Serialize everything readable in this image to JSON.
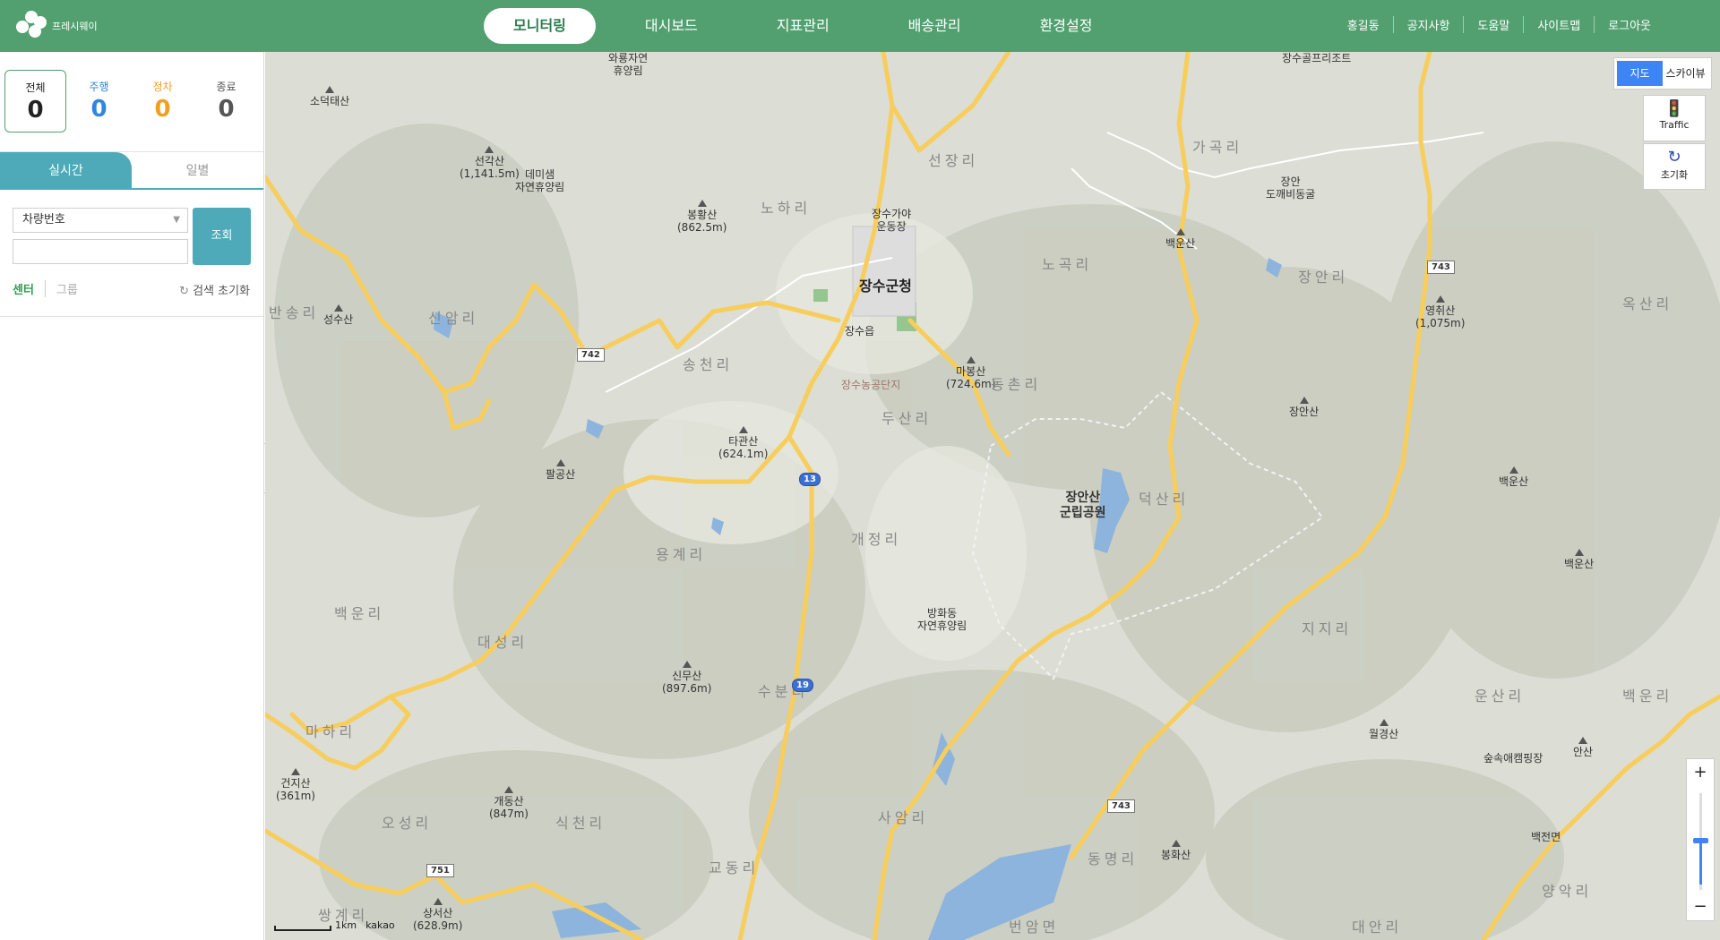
{
  "header": {
    "logo_text": "프레시웨이",
    "nav": [
      "모니터링",
      "대시보드",
      "지표관리",
      "배송관리",
      "환경설정"
    ],
    "utils": [
      "홍길동",
      "공지사항",
      "도움말",
      "사이트맵",
      "로그아웃"
    ]
  },
  "stats": [
    {
      "label": "전체",
      "value": "0",
      "color": "#222222"
    },
    {
      "label": "주행",
      "value": "0",
      "color": "#2e86de"
    },
    {
      "label": "정차",
      "value": "0",
      "color": "#f0a020"
    },
    {
      "label": "종료",
      "value": "0",
      "color": "#555555"
    }
  ],
  "tabs": [
    "실시간",
    "일별"
  ],
  "search": {
    "select_value": "차량번호",
    "input_value": "",
    "button": "조회",
    "filter_center": "센터",
    "filter_group": "그룹",
    "reset": "검색 초기화"
  },
  "map": {
    "type_options": [
      "지도",
      "스카이뷰"
    ],
    "traffic": "Traffic",
    "reset": "초기화",
    "zoom_in": "+",
    "zoom_out": "−",
    "scale": "1km",
    "provider": "kakao",
    "places": {
      "p1": "소덕태산",
      "p2": "선각산",
      "p2e": "(1,141.5m)",
      "p3": "데미샘",
      "p3b": "자연휴양림",
      "p4": "봉황산",
      "p4e": "(862.5m)",
      "p5": "와룡자연",
      "p5b": "휴양림",
      "p6": "성수산",
      "p7": "팔공산",
      "p8": "타관산",
      "p8e": "(624.1m)",
      "p9": "마봉산",
      "p9e": "(724.6m)",
      "p10": "장수가야",
      "p10b": "운동장",
      "p11": "장수군청",
      "p12": "장수읍",
      "p13": "장수농공단지",
      "p14": "장안산",
      "p14b": "군립공원",
      "p15": "방화동",
      "p15b": "자연휴양림",
      "p16": "신무산",
      "p16e": "(897.6m)",
      "p17": "개동산",
      "p17e": "(847m)",
      "p18": "건지산",
      "p18e": "(361m)",
      "p19": "상서산",
      "p19e": "(628.9m)",
      "p20": "장수골프리조트",
      "p21": "장안",
      "p21b": "도깨비동굴",
      "p22": "백운산",
      "p23": "영취산",
      "p23e": "(1,075m)",
      "p24": "장안산",
      "p25": "백운산",
      "p26": "백운산",
      "p27": "월경산",
      "p28": "숲속애캠핑장",
      "p29": "안산",
      "p30": "봉화산",
      "p31": "백전면",
      "r1": "선장리",
      "r2": "노하리",
      "r3": "가곡리",
      "r4": "노곡리",
      "r5": "장안리",
      "r6": "옥산리",
      "r7": "반송리",
      "r8": "신암리",
      "r9": "송천리",
      "r10": "두산리",
      "r11": "동촌리",
      "r12": "덕산리",
      "r13": "개정리",
      "r14": "용계리",
      "r15": "백운리",
      "r16": "대성리",
      "r17": "수분리",
      "r18": "지지리",
      "r19": "운산리",
      "r20": "백운리",
      "r21": "마하리",
      "r22": "오성리",
      "r23": "식천리",
      "r24": "사암리",
      "r25": "교동리",
      "r26": "동명리",
      "r27": "쌍계리",
      "r28": "대안리",
      "r29": "번암면",
      "r30": "양악리",
      "s742": "742",
      "s743a": "743",
      "s743b": "743",
      "s751": "751",
      "s13": "13",
      "s19": "19"
    }
  }
}
